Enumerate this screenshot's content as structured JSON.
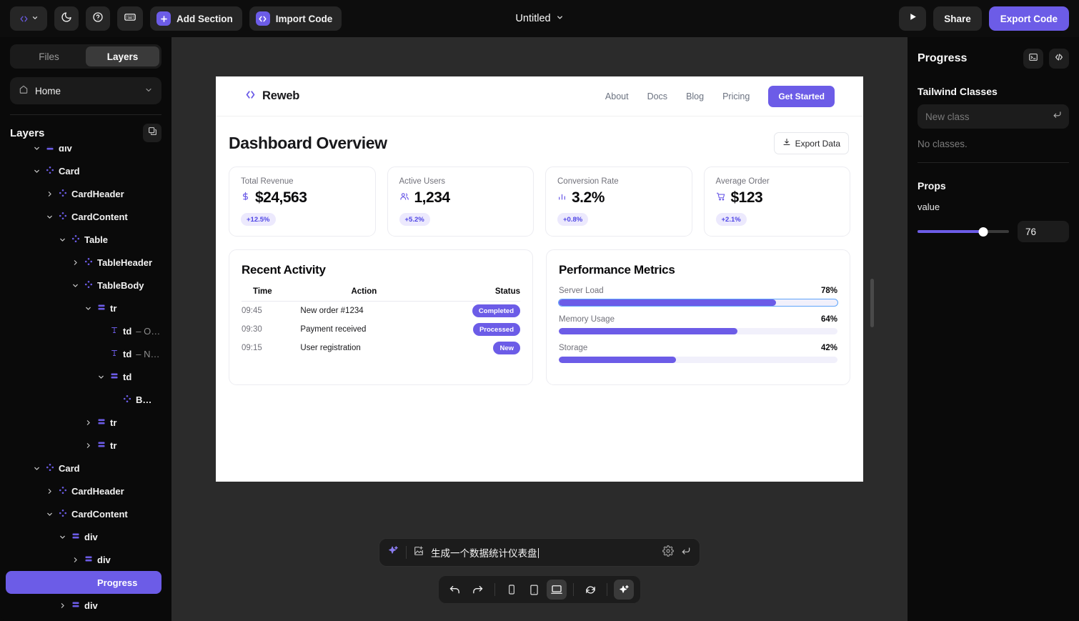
{
  "topbar": {
    "logo_icon": "code-brackets-icon",
    "logo_chevron": "chevron-down-icon",
    "theme_icon": "moon-icon",
    "help_icon": "question-circle-icon",
    "keyboard_icon": "keyboard-icon",
    "add_section_label": "Add Section",
    "add_section_icon": "plus-icon",
    "import_code_label": "Import Code",
    "import_code_icon": "code-brackets-icon",
    "doc_title": "Untitled",
    "doc_title_chevron": "chevron-down-icon",
    "play_icon": "play-icon",
    "share_label": "Share",
    "export_code_label": "Export Code"
  },
  "sidebar": {
    "tabs": [
      {
        "label": "Files",
        "active": false
      },
      {
        "label": "Layers",
        "active": true
      }
    ],
    "page": {
      "icon": "home-icon",
      "label": "Home",
      "chevron": "chevron-down-icon"
    },
    "layers_title": "Layers",
    "duplicate_icon": "copy-icon",
    "tree": [
      {
        "label": "div",
        "sub": "",
        "depth": 2,
        "twisty": "down",
        "icon": "stack-icon",
        "selected": false,
        "clipped": true
      },
      {
        "label": "Card",
        "sub": "",
        "depth": 2,
        "twisty": "down",
        "icon": "component-icon",
        "selected": false
      },
      {
        "label": "CardHeader",
        "sub": "",
        "depth": 3,
        "twisty": "right",
        "icon": "component-icon",
        "selected": false
      },
      {
        "label": "CardContent",
        "sub": "",
        "depth": 3,
        "twisty": "down",
        "icon": "component-icon",
        "selected": false
      },
      {
        "label": "Table",
        "sub": "",
        "depth": 4,
        "twisty": "down",
        "icon": "component-icon",
        "selected": false
      },
      {
        "label": "TableHeader",
        "sub": "",
        "depth": 5,
        "twisty": "right",
        "icon": "component-icon",
        "selected": false
      },
      {
        "label": "TableBody",
        "sub": "",
        "depth": 5,
        "twisty": "down",
        "icon": "component-icon",
        "selected": false
      },
      {
        "label": "tr",
        "sub": "",
        "depth": 6,
        "twisty": "down",
        "icon": "stack-icon",
        "selected": false
      },
      {
        "label": "td",
        "sub": "– O…",
        "depth": 7,
        "twisty": "none",
        "icon": "text-icon",
        "selected": false
      },
      {
        "label": "td",
        "sub": "– N…",
        "depth": 7,
        "twisty": "none",
        "icon": "text-icon",
        "selected": false
      },
      {
        "label": "td",
        "sub": "",
        "depth": 7,
        "twisty": "down",
        "icon": "stack-icon",
        "selected": false
      },
      {
        "label": "B…",
        "sub": "",
        "depth": 8,
        "twisty": "none",
        "icon": "component-icon",
        "selected": false
      },
      {
        "label": "tr",
        "sub": "",
        "depth": 6,
        "twisty": "right",
        "icon": "stack-icon",
        "selected": false
      },
      {
        "label": "tr",
        "sub": "",
        "depth": 6,
        "twisty": "right",
        "icon": "stack-icon",
        "selected": false
      },
      {
        "label": "Card",
        "sub": "",
        "depth": 2,
        "twisty": "down",
        "icon": "component-icon",
        "selected": false
      },
      {
        "label": "CardHeader",
        "sub": "",
        "depth": 3,
        "twisty": "right",
        "icon": "component-icon",
        "selected": false
      },
      {
        "label": "CardContent",
        "sub": "",
        "depth": 3,
        "twisty": "down",
        "icon": "component-icon",
        "selected": false
      },
      {
        "label": "div",
        "sub": "",
        "depth": 4,
        "twisty": "down",
        "icon": "stack-icon",
        "selected": false
      },
      {
        "label": "div",
        "sub": "",
        "depth": 5,
        "twisty": "right",
        "icon": "stack-icon",
        "selected": false
      },
      {
        "label": "Progress",
        "sub": "",
        "depth": 5,
        "twisty": "none",
        "icon": "component-icon",
        "selected": true
      },
      {
        "label": "div",
        "sub": "",
        "depth": 4,
        "twisty": "right",
        "icon": "stack-icon",
        "selected": false
      }
    ]
  },
  "preview": {
    "brand": {
      "name": "Reweb",
      "icon": "code-brackets-icon"
    },
    "nav_links": [
      "About",
      "Docs",
      "Blog",
      "Pricing"
    ],
    "cta_label": "Get Started",
    "page_title": "Dashboard Overview",
    "export_data_label": "Export Data",
    "export_data_icon": "download-icon",
    "stats": [
      {
        "label": "Total Revenue",
        "value": "$24,563",
        "badge": "+12.5%",
        "icon": "dollar-icon"
      },
      {
        "label": "Active Users",
        "value": "1,234",
        "badge": "+5.2%",
        "icon": "users-icon"
      },
      {
        "label": "Conversion Rate",
        "value": "3.2%",
        "badge": "+0.8%",
        "icon": "bar-chart-icon"
      },
      {
        "label": "Average Order",
        "value": "$123",
        "badge": "+2.1%",
        "icon": "shopping-cart-icon"
      }
    ],
    "activity": {
      "title": "Recent Activity",
      "columns": [
        "Time",
        "Action",
        "Status"
      ],
      "rows": [
        {
          "time": "09:45",
          "action": "New order #1234",
          "status": "Completed"
        },
        {
          "time": "09:30",
          "action": "Payment received",
          "status": "Processed"
        },
        {
          "time": "09:15",
          "action": "User registration",
          "status": "New"
        }
      ]
    },
    "metrics": {
      "title": "Performance Metrics",
      "items": [
        {
          "name": "Server Load",
          "value": "78%",
          "percent": 78,
          "selected": true
        },
        {
          "name": "Memory Usage",
          "value": "64%",
          "percent": 64,
          "selected": false
        },
        {
          "name": "Storage",
          "value": "42%",
          "percent": 42,
          "selected": false
        }
      ]
    }
  },
  "prompt": {
    "sparkle_icon": "ai-sparkle-icon",
    "image_icon": "add-image-icon",
    "text": "生成一个数据统计仪表盘",
    "settings_icon": "gear-icon",
    "submit_icon": "enter-return-icon"
  },
  "toolbar": {
    "items": [
      {
        "name": "undo-button",
        "icon": "undo-icon",
        "active": false
      },
      {
        "name": "redo-button",
        "icon": "redo-icon",
        "active": false
      },
      {
        "name": "mobile-view-button",
        "icon": "phone-icon",
        "active": false
      },
      {
        "name": "tablet-view-button",
        "icon": "tablet-icon",
        "active": false
      },
      {
        "name": "desktop-view-button",
        "icon": "laptop-icon",
        "active": true
      },
      {
        "name": "refresh-button",
        "icon": "refresh-icon",
        "active": false
      },
      {
        "name": "ai-assist-button",
        "icon": "ai-sparkle-icon",
        "active": true
      }
    ]
  },
  "right_panel": {
    "title": "Progress",
    "terminal_icon": "terminal-icon",
    "code_icon": "code-brackets-icon",
    "tailwind_section": "Tailwind Classes",
    "new_class_placeholder": "New class",
    "new_class_value": "",
    "enter_icon": "enter-return-icon",
    "no_classes": "No classes.",
    "props_section": "Props",
    "prop_name": "value",
    "prop_value": "76",
    "prop_percent": 72
  },
  "colors": {
    "accent": "#6c5ce7",
    "panel_bg": "#0a0a0a",
    "canvas_bg": "#2b2b2b",
    "badge_bg": "#ece9fd",
    "badge_text": "#4f46e5"
  }
}
